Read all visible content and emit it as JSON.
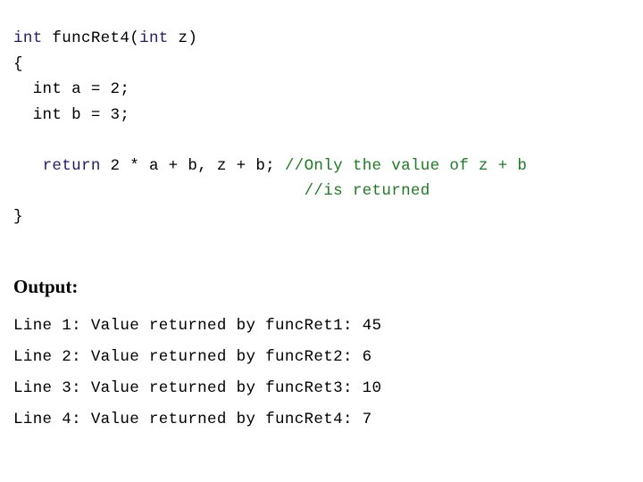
{
  "slide": {
    "background_color": "#ffffff",
    "colors": {
      "keyword": "#201a6b",
      "plain": "#000000",
      "comment": "#1d7a22"
    }
  },
  "code": {
    "lines": [
      {
        "id": "signature",
        "segments": [
          {
            "text": "int",
            "style": "keyword"
          },
          {
            "text": " funcRet4(",
            "style": "plain"
          },
          {
            "text": "int",
            "style": "keyword"
          },
          {
            "text": " z)",
            "style": "plain"
          }
        ]
      },
      {
        "id": "open-brace",
        "segments": [
          {
            "text": "{",
            "style": "plain"
          }
        ]
      },
      {
        "id": "decl-a",
        "segments": [
          {
            "text": "  int a = 2;",
            "style": "plain"
          }
        ]
      },
      {
        "id": "decl-b",
        "segments": [
          {
            "text": "  int b = 3;",
            "style": "plain"
          }
        ]
      },
      {
        "id": "blank",
        "segments": []
      },
      {
        "id": "return-statement",
        "segments": [
          {
            "text": "   ",
            "style": "plain"
          },
          {
            "text": "return",
            "style": "keyword"
          },
          {
            "text": " 2 * a + b, z + b; ",
            "style": "plain"
          },
          {
            "text": "//Only the value of z + b",
            "style": "comment"
          }
        ]
      },
      {
        "id": "comment-continuation",
        "segments": [
          {
            "text": "                              ",
            "style": "plain"
          },
          {
            "text": "//is returned",
            "style": "comment"
          }
        ]
      },
      {
        "id": "close-brace",
        "segments": [
          {
            "text": "}",
            "style": "plain"
          }
        ]
      }
    ]
  },
  "output": {
    "heading": "Output:",
    "lines": [
      "Line 1: Value returned by funcRet1: 45",
      "Line 2: Value returned by funcRet2: 6",
      "Line 3: Value returned by funcRet3: 10",
      "Line 4: Value returned by funcRet4: 7"
    ]
  }
}
